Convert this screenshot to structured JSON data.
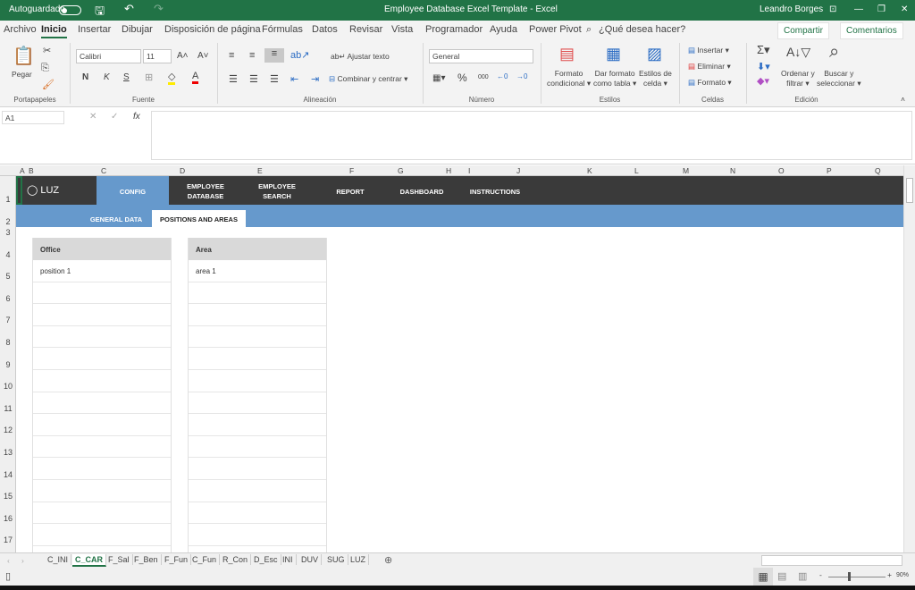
{
  "titlebar": {
    "autosave": "Autoguardado",
    "title": "Employee Database Excel Template  -  Excel",
    "user": "Leandro Borges"
  },
  "menu": [
    "Archivo",
    "Inicio",
    "Insertar",
    "Dibujar",
    "Disposición de página",
    "Fórmulas",
    "Datos",
    "Revisar",
    "Vista",
    "Programador",
    "Ayuda",
    "Power Pivot"
  ],
  "search": "¿Qué desea hacer?",
  "share": "Compartir",
  "comments": "Comentarios",
  "ribbon": {
    "paste": "Pegar",
    "font": "Calibri",
    "size": "11",
    "wrap": "Ajustar texto",
    "merge": "Combinar y centrar",
    "number_format": "General",
    "bold": "N",
    "italic": "K",
    "underline": "S",
    "cond_format": [
      "Formato",
      "condicional ▾"
    ],
    "table_format": [
      "Dar formato",
      "como tabla ▾"
    ],
    "cell_styles": [
      "Estilos de",
      "celda ▾"
    ],
    "insert": "Insertar",
    "delete": "Eliminar",
    "format": "Formato",
    "sort": [
      "Ordenar y",
      "filtrar ▾"
    ],
    "find": [
      "Buscar y",
      "seleccionar ▾"
    ],
    "groups": [
      "Portapapeles",
      "Fuente",
      "Alineación",
      "Número",
      "Estilos",
      "Celdas",
      "Edición"
    ]
  },
  "namebox": "A1",
  "fx": "fx",
  "columns": [
    "A",
    "B",
    "C",
    "D",
    "E",
    "F",
    "G",
    "H",
    "I",
    "J",
    "K",
    "L",
    "M",
    "N",
    "O",
    "P",
    "Q"
  ],
  "rows": [
    "1",
    "2",
    "3",
    "4",
    "5",
    "6",
    "7",
    "8",
    "9",
    "10",
    "11",
    "12",
    "13",
    "14",
    "15",
    "16",
    "17"
  ],
  "logo": "LUZ",
  "nav": [
    [
      "CONFIG"
    ],
    [
      "EMPLOYEE",
      "DATABASE"
    ],
    [
      "EMPLOYEE",
      "SEARCH"
    ],
    [
      "REPORT"
    ],
    [
      "DASHBOARD"
    ],
    [
      "INSTRUCTIONS"
    ]
  ],
  "subnav": [
    "GENERAL DATA",
    "POSITIONS AND AREAS"
  ],
  "tables": [
    {
      "header": "Office",
      "rows": [
        "position 1"
      ]
    },
    {
      "header": "Area",
      "rows": [
        "area 1"
      ]
    }
  ],
  "sheets": [
    "C_INI",
    "C_CAR",
    "F_Sal",
    "F_Ben",
    "F_Fun",
    "C_Fun",
    "R_Con",
    "D_Esc",
    "INI",
    "DUV",
    "SUG",
    "LUZ"
  ],
  "zoom": "90%",
  "colors": {
    "green": "#217346",
    "nav": "#3a3a3a",
    "blue": "#6699cc"
  }
}
